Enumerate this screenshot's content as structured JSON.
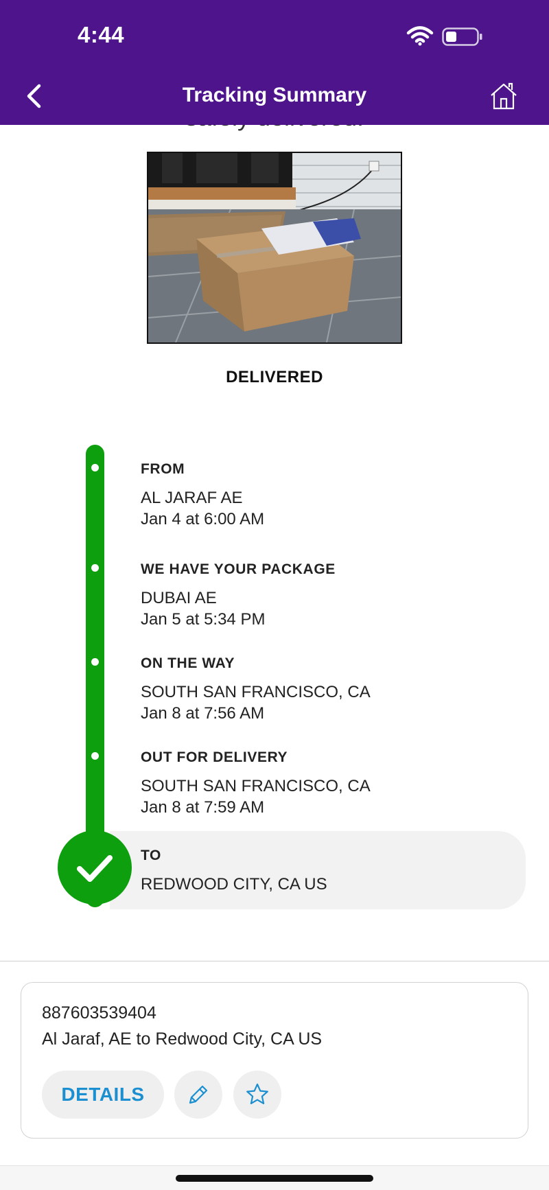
{
  "status_bar": {
    "time": "4:44",
    "wifi_icon": "wifi-icon",
    "battery_icon": "battery-icon"
  },
  "header": {
    "title": "Tracking Summary",
    "back_icon": "chevron-left-icon",
    "home_icon": "home-icon",
    "color": "#4d148c"
  },
  "delivery_message_partial": "safely delivered.",
  "photo": {
    "zoom_icon": "zoom-in-icon"
  },
  "status": "DELIVERED",
  "timeline": {
    "color": "#0e9f0e",
    "events": [
      {
        "title": "FROM",
        "location": "AL JARAF AE",
        "time": "Jan 4 at 6:00 AM"
      },
      {
        "title": "WE HAVE YOUR PACKAGE",
        "location": "DUBAI AE",
        "time": "Jan 5 at 5:34 PM"
      },
      {
        "title": "ON THE WAY",
        "location": "SOUTH SAN FRANCISCO, CA",
        "time": "Jan 8 at 7:56 AM"
      },
      {
        "title": "OUT FOR DELIVERY",
        "location": "SOUTH SAN FRANCISCO, CA",
        "time": "Jan 8 at 7:59 AM"
      }
    ],
    "destination": {
      "title": "TO",
      "location": "REDWOOD CITY, CA  US",
      "icon": "checkmark-icon"
    }
  },
  "shipment": {
    "tracking_number": "887603539404",
    "route": "Al Jaraf, AE to Redwood City, CA US",
    "details_label": "DETAILS",
    "edit_icon": "pencil-icon",
    "favorite_icon": "star-icon",
    "accent": "#1b8fd0"
  }
}
